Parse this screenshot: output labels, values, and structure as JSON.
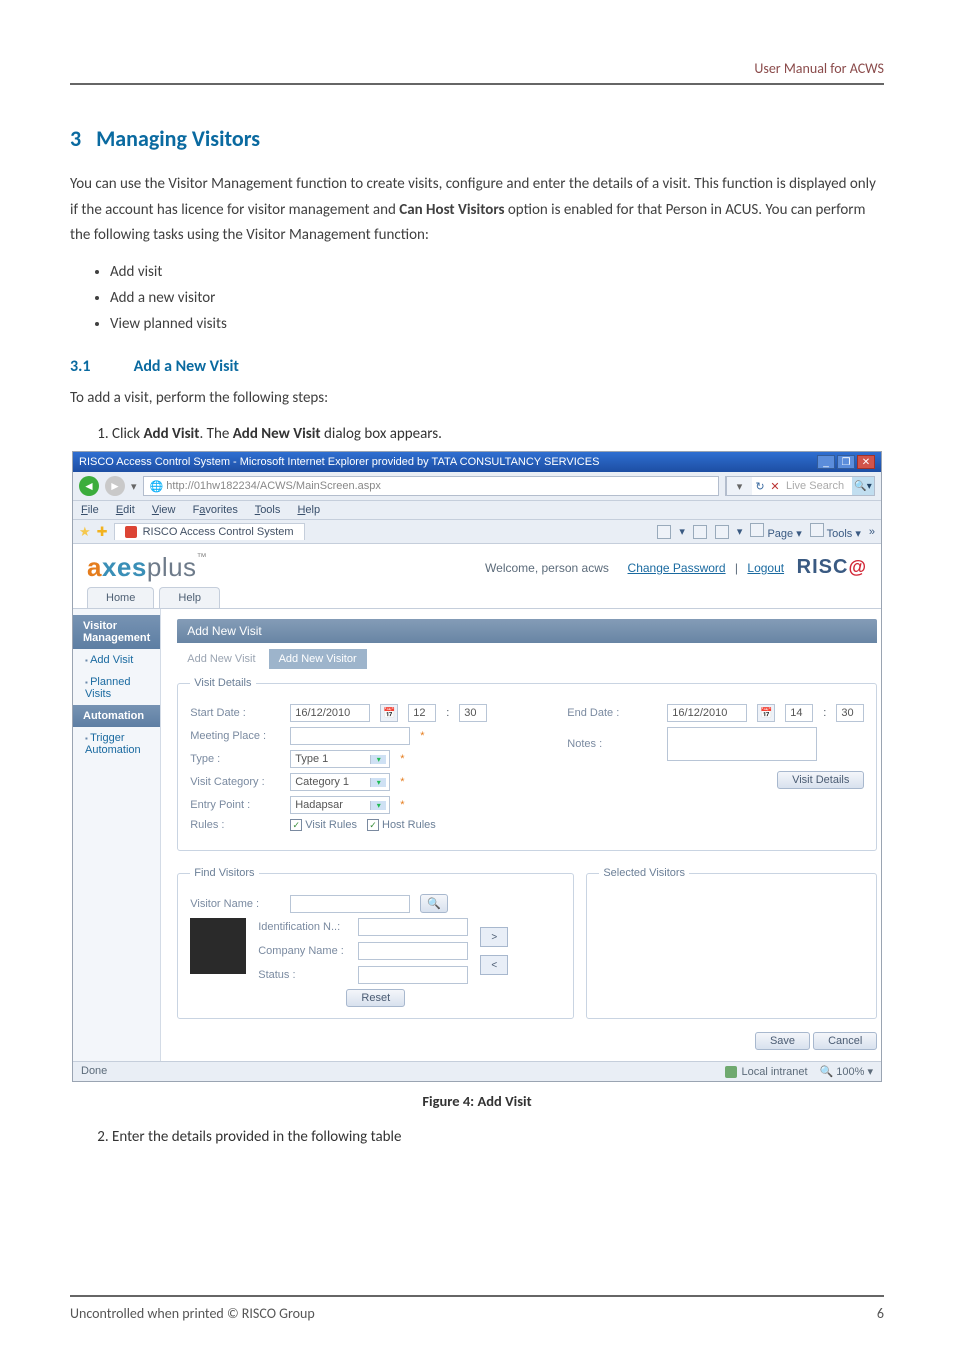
{
  "header": {
    "right_text": "User Manual for ACWS"
  },
  "section": {
    "number": "3",
    "title": "Managing Visitors"
  },
  "intro": "You can use the Visitor Management function to create visits, configure and enter the details of a visit. This function is displayed only if the account has licence for visitor management and Can Host Visitors option is enabled for that Person in ACUS. You can perform the following tasks using the Visitor Management function:",
  "bullets": [
    "Add visit",
    "Add a new visitor",
    "View planned visits"
  ],
  "subsection": {
    "number": "3.1",
    "title": "Add a New Visit"
  },
  "sub_intro": "To add a visit, perform the following steps:",
  "steps": {
    "s1_prefix": "Click ",
    "s1_bold1": "Add Visit",
    "s1_mid": ". The ",
    "s1_bold2": "Add New Visit",
    "s1_suffix": " dialog box appears.",
    "s2": "Enter the details provided in the following table"
  },
  "ie": {
    "title": "RISCO Access Control System - Microsoft Internet Explorer provided by TATA CONSULTANCY SERVICES",
    "addr": "http://01hw182234/ACWS/MainScreen.aspx",
    "search_placeholder": "Live Search",
    "menu": {
      "file": "File",
      "edit": "Edit",
      "view": "View",
      "favorites": "Favorites",
      "tools": "Tools",
      "help": "Help"
    },
    "tab": "RISCO Access Control System",
    "toolbar": {
      "page": "Page",
      "tools": "Tools"
    },
    "status_left": "Done",
    "status_zone": "Local intranet",
    "status_zoom": "100%"
  },
  "app": {
    "welcome": "Welcome, person acws",
    "change_pw": "Change Password",
    "logout": "Logout",
    "tabs": {
      "home": "Home",
      "help": "Help"
    },
    "sidebar": {
      "vm_head": "Visitor Management",
      "add_visit": "Add Visit",
      "planned": "Planned Visits",
      "auto_head": "Automation",
      "trigger": "Trigger Automation"
    },
    "panel": {
      "title": "Add New Visit",
      "subtab1": "Add New Visit",
      "subtab2": "Add New Visitor",
      "visit_details_legend": "Visit Details",
      "start_date_lbl": "Start Date :",
      "start_date_val": "16/12/2010",
      "start_hh": "12",
      "start_mm": "30",
      "end_date_lbl": "End Date :",
      "end_date_val": "16/12/2010",
      "end_hh": "14",
      "end_mm": "30",
      "meeting_lbl": "Meeting Place :",
      "notes_lbl": "Notes :",
      "type_lbl": "Type :",
      "type_val": "Type 1",
      "cat_lbl": "Visit Category :",
      "cat_val": "Category 1",
      "entry_lbl": "Entry Point :",
      "entry_val": "Hadapsar",
      "rules_lbl": "Rules :",
      "visit_rules": "Visit Rules",
      "host_rules": "Host Rules",
      "visit_details_btn": "Visit Details",
      "find_legend": "Find Visitors",
      "visitor_name_lbl": "Visitor Name :",
      "id_lbl": "Identification N..:",
      "company_lbl": "Company Name :",
      "status_lbl": "Status :",
      "reset_btn": "Reset",
      "selected_legend": "Selected Visitors",
      "save_btn": "Save",
      "cancel_btn": "Cancel"
    }
  },
  "figure_caption": "Figure 4: Add Visit",
  "footer": {
    "left": "Uncontrolled when printed © RISCO Group",
    "right": "6"
  }
}
